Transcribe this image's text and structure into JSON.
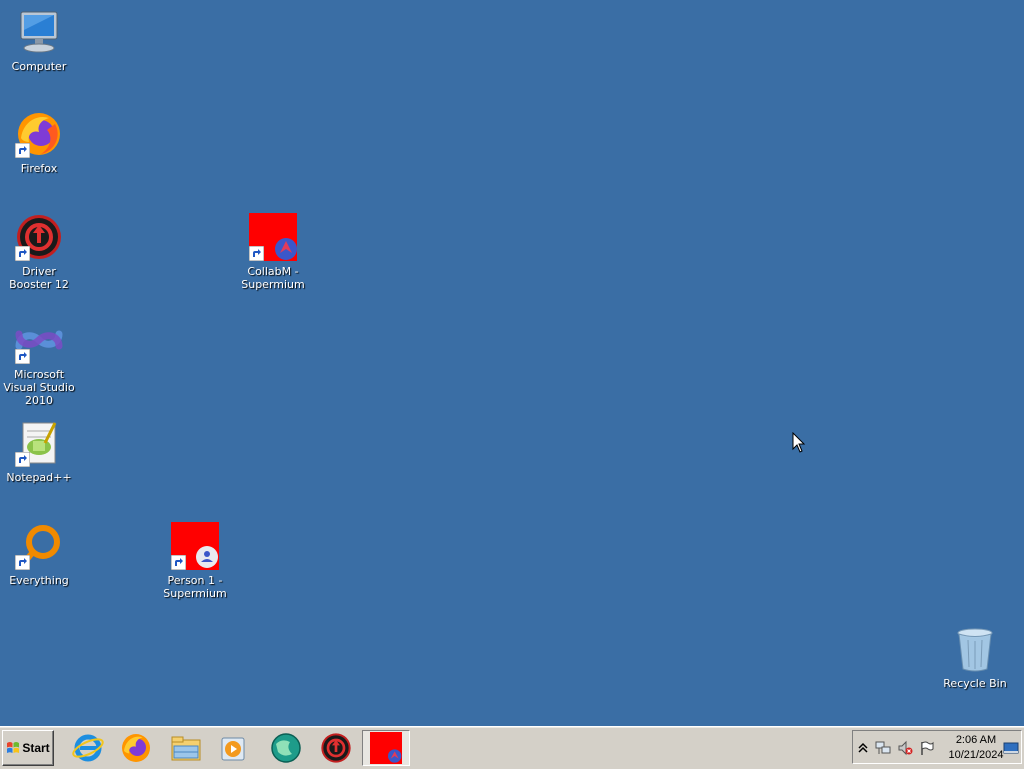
{
  "desktop": {
    "background": "#3a6ea5",
    "icons": [
      {
        "label": "Computer"
      },
      {
        "label": "Firefox"
      },
      {
        "label": "Driver Booster 12"
      },
      {
        "label": "CollabM - Supermium"
      },
      {
        "label": "Microsoft Visual Studio 2010"
      },
      {
        "label": "Notepad++"
      },
      {
        "label": "Everything"
      },
      {
        "label": "Person 1 - Supermium"
      },
      {
        "label": "Recycle Bin"
      }
    ]
  },
  "taskbar": {
    "start_label": "Start",
    "pinned": [
      {
        "icon": "internet-explorer-icon"
      },
      {
        "icon": "firefox-icon"
      },
      {
        "icon": "file-explorer-icon"
      },
      {
        "icon": "media-player-icon"
      },
      {
        "icon": "globe-app-icon"
      },
      {
        "icon": "driver-booster-icon"
      },
      {
        "icon": "supermium-icon",
        "active": true
      }
    ],
    "tray": {
      "icons": [
        "show-hidden-icon",
        "network-icon",
        "volume-muted-icon",
        "action-center-flag-icon"
      ],
      "time": "2:06 AM",
      "date": "10/21/2024"
    }
  }
}
